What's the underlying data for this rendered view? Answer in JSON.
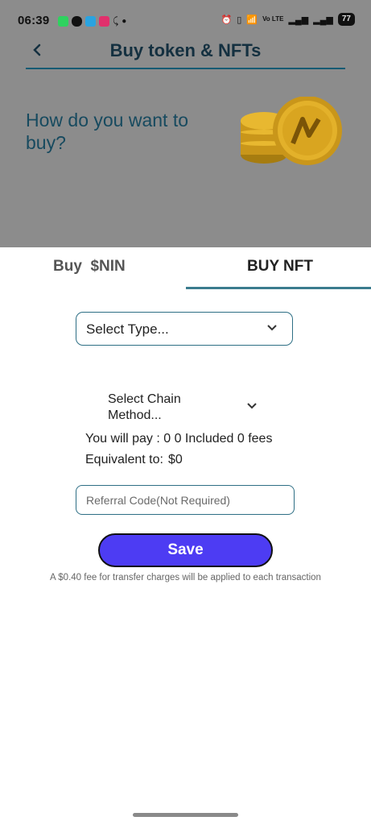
{
  "status_bar": {
    "time": "06:39",
    "battery": "77",
    "network": "Vo LTE"
  },
  "header": {
    "title": "Buy token & NFTs"
  },
  "hero": {
    "question": "How do you want to buy?"
  },
  "tabs": [
    {
      "label": "Buy  $NIN"
    },
    {
      "label": "BUY NFT",
      "selected": true
    }
  ],
  "form": {
    "select_type": "Select Type...",
    "select_chain": "Select Chain Method...",
    "pay_text": "You will pay : 0 0 Included 0 fees",
    "equivalent_label": "Equivalent to:",
    "equivalent_value": "$0",
    "referral_placeholder": "Referral Code(Not Required)",
    "save_label": "Save",
    "fee_note": "A $0.40 fee for transfer charges will be applied to each transaction"
  },
  "colors": {
    "accent": "#4d3cf3",
    "teal": "#2e6f85",
    "overlay": "#8c8c8c",
    "coin": "#e8b830"
  }
}
